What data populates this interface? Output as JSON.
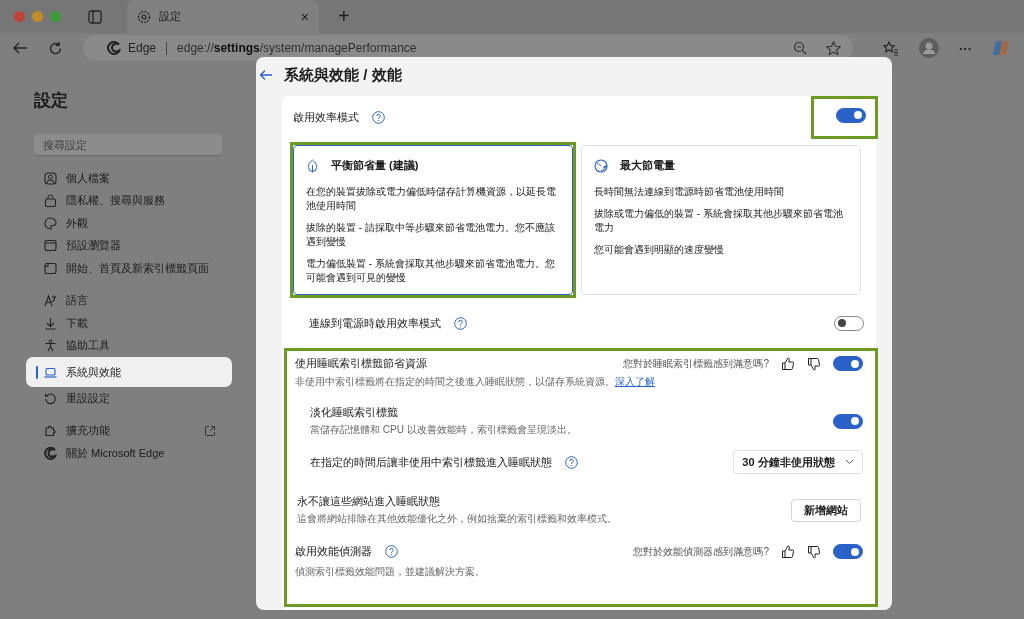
{
  "browser": {
    "tab": {
      "title": "設定",
      "close": "×"
    },
    "new_tab": "+",
    "address": {
      "site": "Edge",
      "scheme": "edge://",
      "host": "settings",
      "path": "/system/managePerformance"
    },
    "more": "···"
  },
  "sidebar": {
    "title": "設定",
    "search": {
      "placeholder": "搜尋設定"
    },
    "groups": [
      [
        {
          "label": "個人檔案",
          "selected": false
        },
        {
          "label": "隱私權、搜尋與服務",
          "selected": false
        },
        {
          "label": "外觀",
          "selected": false
        },
        {
          "label": "預設瀏覽器",
          "selected": false
        },
        {
          "label": "開始、首頁及新索引標籤頁面",
          "selected": false
        }
      ],
      [
        {
          "label": "語言",
          "selected": false
        },
        {
          "label": "下載",
          "selected": false
        },
        {
          "label": "協助工具",
          "selected": false
        },
        {
          "label": "系統與效能",
          "selected": true
        },
        {
          "label": "重設設定",
          "selected": false
        }
      ],
      [
        {
          "label": "擴充功能",
          "selected": false,
          "external": true
        },
        {
          "label": "關於 Microsoft Edge",
          "selected": false,
          "external": false
        }
      ]
    ]
  },
  "panel": {
    "title": "系統與效能 / 效能",
    "efficiency": {
      "label": "啟用效率模式",
      "on": true,
      "highlighted": true
    },
    "modes": [
      {
        "title": "平衡節省量 (建議)",
        "selected": true,
        "highlighted": true,
        "lines": [
          "在您的裝置拔除或電力偏低時儲存計算機資源，以延長電池使用時間",
          "拔除的裝置 - 請採取中等步驟來節省電池電力。您不應該遇到變慢",
          "電力偏低裝置 - 系統會採取其他步驟來節省電池電力。您可能會遇到可見的變慢"
        ]
      },
      {
        "title": "最大節電量",
        "selected": false,
        "highlighted": false,
        "lines": [
          "長時間無法連線到電源時節省電池使用時間",
          "拔除或電力偏低的裝置 - 系統會採取其他步驟來節省電池電力",
          "您可能會遇到明顯的速度變慢"
        ]
      }
    ],
    "plugged_in": {
      "label": "連線到電源時啟用效率模式",
      "on": false
    },
    "section": {
      "highlighted": true,
      "sleeping_tabs": {
        "label": "使用睡眠索引標籤節省資源",
        "feedback": "您對於睡眠索引標籤感到滿意嗎?",
        "on": true,
        "description": "非使用中索引標籤將在指定的時間之後進入睡眠狀態，以儲存系統資源。",
        "link": "深入了解"
      },
      "fade": {
        "label": "淡化睡眠索引標籤",
        "description": "當儲存記憶體和 CPU 以改善效能時，索引標籤會呈現淡出。",
        "on": true
      },
      "timeout": {
        "label": "在指定的時間后讓非使用中索引標籤進入睡眠狀態",
        "value": "30 分鐘非使用狀態"
      },
      "never_sleep": {
        "label": "永不讓這些網站進入睡眠狀態",
        "description": "這會將網站排除在其他效能優化之外，例如捨棄的索引標籤和效率模式。",
        "button": "新增網站"
      },
      "detector": {
        "label": "啟用效能偵測器",
        "feedback": "您對於效能偵測器感到滿意嗎?",
        "on": true,
        "description": "偵測索引標籤效能問題，並建議解決方案。"
      }
    }
  }
}
